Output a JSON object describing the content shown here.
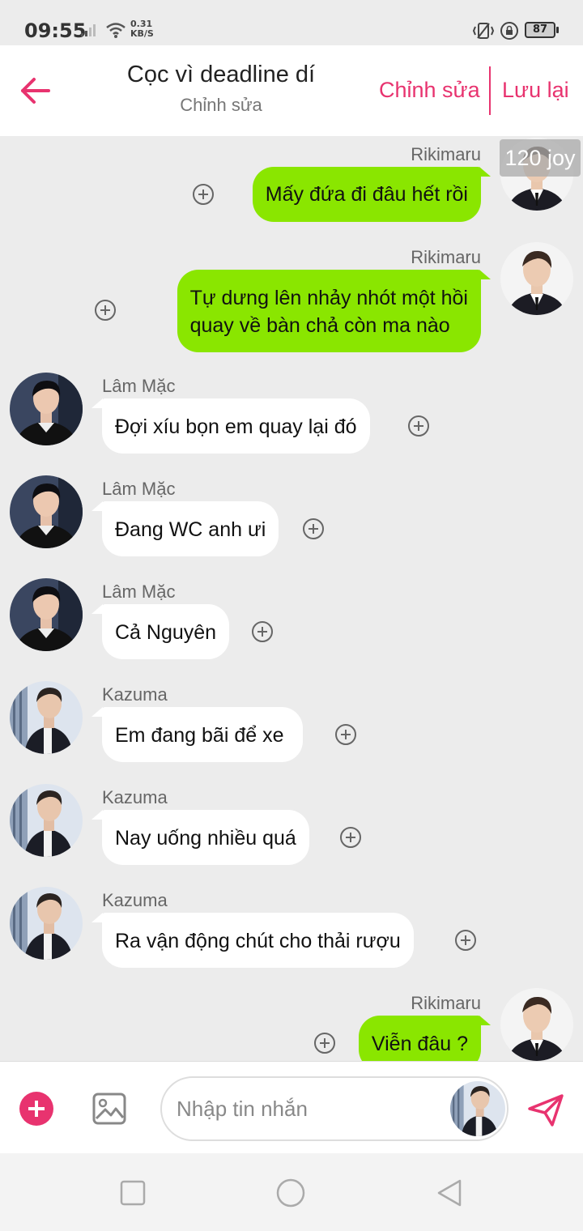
{
  "status_bar": {
    "time": "09:55",
    "net_speed_value": "0.31",
    "net_speed_unit": "KB/S",
    "battery": "87"
  },
  "header": {
    "title": "Cọc vì deadline dí",
    "subtitle": "Chỉnh sửa",
    "edit_label": "Chỉnh sửa",
    "save_label": "Lưu lại"
  },
  "watermark": "120 joy",
  "messages": [
    {
      "sender": "Rikimaru",
      "side": "right",
      "text": "Mấy đứa đi đâu hết rồi"
    },
    {
      "sender": "Rikimaru",
      "side": "right",
      "lines": [
        "Tự dưng lên nhảy nhót một hồi",
        "quay về bàn chả còn ma nào"
      ]
    },
    {
      "sender": "Lâm Mặc",
      "side": "left",
      "text": "Đợi xíu bọn em quay lại đó"
    },
    {
      "sender": "Lâm Mặc",
      "side": "left",
      "text": "Đang WC anh ưi"
    },
    {
      "sender": "Lâm Mặc",
      "side": "left",
      "text": "Cả Nguyên"
    },
    {
      "sender": "Kazuma",
      "side": "left",
      "text": "Em đang bãi để xe"
    },
    {
      "sender": "Kazuma",
      "side": "left",
      "text": "Nay uống nhiều quá"
    },
    {
      "sender": "Kazuma",
      "side": "left",
      "text": "Ra vận động chút cho thải rượu"
    },
    {
      "sender": "Rikimaru",
      "side": "right",
      "text": "Viễn đâu ?"
    }
  ],
  "input": {
    "placeholder": "Nhập tin nhắn"
  },
  "colors": {
    "accent": "#e8336f",
    "outgoing_bubble": "#8ae600",
    "incoming_bubble": "#ffffff",
    "background": "#ececec"
  },
  "icons": [
    "back-arrow-icon",
    "add-icon",
    "image-icon",
    "send-icon",
    "recent-apps-icon",
    "home-icon",
    "back-icon"
  ]
}
